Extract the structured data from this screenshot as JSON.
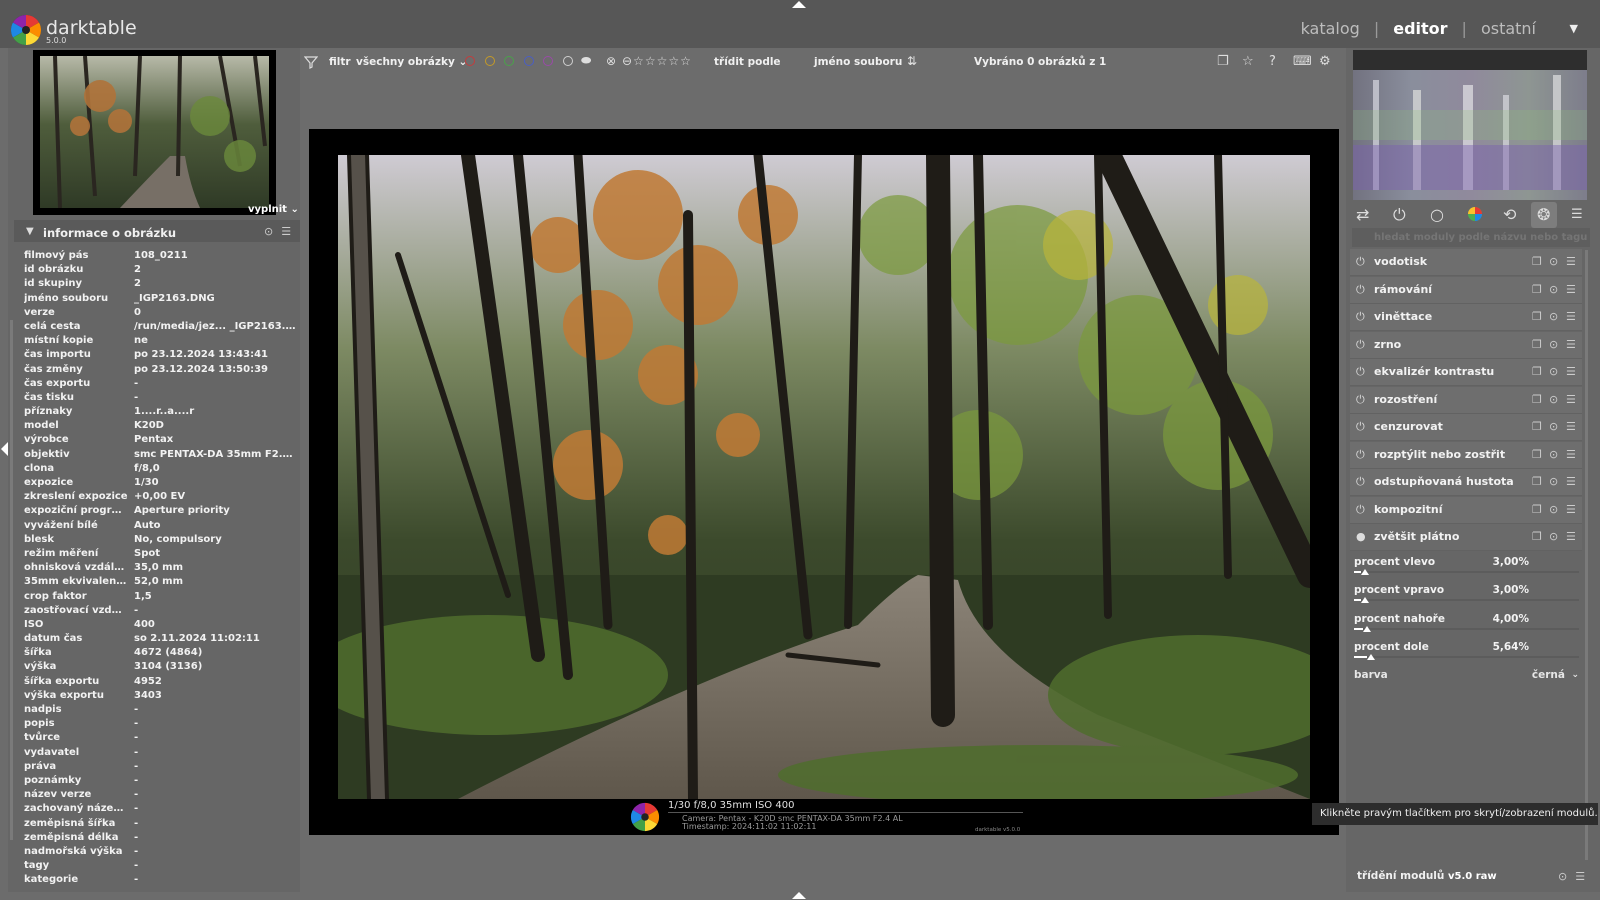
{
  "app": {
    "name": "darktable",
    "version": "5.0.0"
  },
  "views": [
    {
      "label": "katalog",
      "active": false
    },
    {
      "label": "editor",
      "active": true
    },
    {
      "label": "ostatní",
      "active": false
    }
  ],
  "left": {
    "fit_label": "vyplnit",
    "info_title": "informace o obrázku",
    "info_rows": [
      {
        "label": "filmový pás",
        "value": "108_0211"
      },
      {
        "label": "id obrázku",
        "value": "2"
      },
      {
        "label": "id skupiny",
        "value": "2"
      },
      {
        "label": "jméno souboru",
        "value": "_IGP2163.DNG"
      },
      {
        "label": "verze",
        "value": "0"
      },
      {
        "label": "celá cesta",
        "value": "/run/media/jez... _IGP2163.DNG"
      },
      {
        "label": "místní kopie",
        "value": "ne"
      },
      {
        "label": "čas importu",
        "value": "po 23.12.2024 13:43:41"
      },
      {
        "label": "čas změny",
        "value": "po 23.12.2024 13:50:39"
      },
      {
        "label": "čas exportu",
        "value": "-"
      },
      {
        "label": "čas tisku",
        "value": "-"
      },
      {
        "label": "příznaky",
        "value": "1....r..a....r"
      },
      {
        "label": "model",
        "value": "K20D"
      },
      {
        "label": "výrobce",
        "value": "Pentax"
      },
      {
        "label": "objektiv",
        "value": "smc PENTAX-DA 35mm F2.4 AL"
      },
      {
        "label": "clona",
        "value": "f/8,0"
      },
      {
        "label": "expozice",
        "value": "1/30"
      },
      {
        "label": "zkreslení expozice",
        "value": "+0,00 EV"
      },
      {
        "label": "expoziční program",
        "value": "Aperture priority"
      },
      {
        "label": "vyvážení bílé",
        "value": "Auto"
      },
      {
        "label": "blesk",
        "value": "No, compulsory"
      },
      {
        "label": "režim měření",
        "value": "Spot"
      },
      {
        "label": "ohnisková vzdáleno...",
        "value": "35,0 mm"
      },
      {
        "label": "35mm ekvivalentní ...",
        "value": "52,0 mm"
      },
      {
        "label": "crop faktor",
        "value": "1,5"
      },
      {
        "label": "zaostřovací vzdále...",
        "value": "-"
      },
      {
        "label": "ISO",
        "value": "400"
      },
      {
        "label": "datum čas",
        "value": "so 2.11.2024 11:02:11"
      },
      {
        "label": "šířka",
        "value": "4672 (4864)"
      },
      {
        "label": "výška",
        "value": "3104 (3136)"
      },
      {
        "label": "šířka exportu",
        "value": "4952"
      },
      {
        "label": "výška exportu",
        "value": "3403"
      },
      {
        "label": "nadpis",
        "value": "-"
      },
      {
        "label": "popis",
        "value": "-"
      },
      {
        "label": "tvůrce",
        "value": "-"
      },
      {
        "label": "vydavatel",
        "value": "-"
      },
      {
        "label": "práva",
        "value": "-"
      },
      {
        "label": "poznámky",
        "value": "-"
      },
      {
        "label": "název verze",
        "value": "-"
      },
      {
        "label": "zachovaný název s...",
        "value": "-"
      },
      {
        "label": "zeměpisná šířka",
        "value": "-"
      },
      {
        "label": "zeměpisná délka",
        "value": "-"
      },
      {
        "label": "nadmořská výška",
        "value": "-"
      },
      {
        "label": "tagy",
        "value": "-"
      },
      {
        "label": "kategorie",
        "value": "-"
      }
    ]
  },
  "filterbar": {
    "filter_label": "filtr",
    "filter_value": "všechny obrázky",
    "sort_label": "třídit podle",
    "sort_value": "jméno souboru",
    "selected_text": "Vybráno 0 obrázků z 1",
    "color_labels": [
      "#c43c3c",
      "#c49a28",
      "#4aa24a",
      "#4a5ec4",
      "#9a4aa8"
    ]
  },
  "watermark": {
    "line1": "1/30 f/8,0 35mm ISO 400",
    "line2": "Camera: Pentax - K20D smc PENTAX-DA 35mm F2.4 AL",
    "line3": "Timestamp: 2024:11:02 11:02:11",
    "dt": "darktable v5.0.0"
  },
  "right": {
    "search_placeholder": "hledat moduly podle názvu nebo tagu",
    "modules": [
      {
        "name": "vodotisk"
      },
      {
        "name": "rámování"
      },
      {
        "name": "viněttace"
      },
      {
        "name": "zrno"
      },
      {
        "name": "ekvalizér kontrastu"
      },
      {
        "name": "rozostření"
      },
      {
        "name": "cenzurovat"
      },
      {
        "name": "rozptýlit nebo zostřit"
      },
      {
        "name": "odstupňovaná hustota"
      },
      {
        "name": "kompozitní"
      },
      {
        "name": "zvětšit plátno"
      }
    ],
    "sliders": [
      {
        "label": "procent vlevo",
        "value": "3,00%",
        "level": 0.03
      },
      {
        "label": "procent vpravo",
        "value": "3,00%",
        "level": 0.03
      },
      {
        "label": "procent nahoře",
        "value": "4,00%",
        "level": 0.04
      },
      {
        "label": "procent dole",
        "value": "5,64%",
        "level": 0.0564
      }
    ],
    "color_label": "barva",
    "color_value": "černá",
    "tooltip": "Klikněte pravým tlačítkem pro skrytí/zobrazení modulů.",
    "module_sort": "třídění modulů",
    "preset": "v5.0 raw"
  }
}
